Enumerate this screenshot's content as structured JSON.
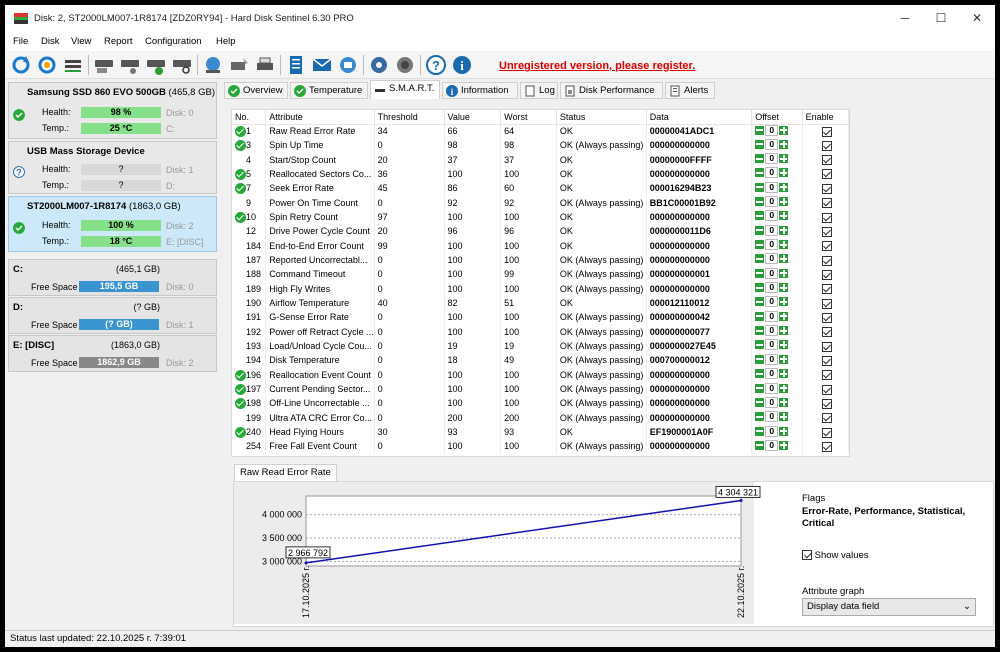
{
  "window": {
    "title": "Disk: 2, ST2000LM007-1R8174 [ZDZ0RY94]  -  Hard Disk Sentinel 6.30 PRO",
    "minimize": "─",
    "maximize": "☐",
    "close": "✕"
  },
  "menu": [
    "File",
    "Disk",
    "View",
    "Report",
    "Configuration",
    "Help"
  ],
  "toolbar": {
    "icons": [
      "refresh-icon",
      "refresh-all-icon",
      "disk-details-icon",
      "disk-test-icon",
      "disk-surface-icon",
      "disk-ok-icon",
      "disk-search-icon",
      "network-icon",
      "tools-icon",
      "printer-icon",
      "report-icon",
      "email-icon",
      "send-icon",
      "settings-icon",
      "sound-icon",
      "help-icon",
      "info-icon"
    ],
    "unregistered": "Unregistered version, please register."
  },
  "disks": [
    {
      "name": "Samsung SSD 860 EVO 500GB",
      "size": "(465,8 GB)",
      "health_label": "Health:",
      "health": "98 %",
      "health_pct": 98,
      "temp_label": "Temp.:",
      "temp": "25 °C",
      "disk_no": "Disk: 0",
      "drive": "C:",
      "status": "ok"
    },
    {
      "name": "USB Mass Storage Device",
      "size": "",
      "health_label": "Health:",
      "health": "?",
      "health_pct": 0,
      "temp_label": "Temp.:",
      "temp": "?",
      "disk_no": "Disk: 1",
      "drive": "D:",
      "status": "unknown"
    },
    {
      "name": "ST2000LM007-1R8174",
      "size": "(1863,0 GB)",
      "health_label": "Health:",
      "health": "100 %",
      "health_pct": 100,
      "temp_label": "Temp.:",
      "temp": "18 °C",
      "disk_no": "Disk: 2",
      "drive": "E: [DISC]",
      "status": "ok"
    }
  ],
  "volumes": [
    {
      "name": "C:",
      "size": "(465,1 GB)",
      "free_label": "Free Space",
      "free": "195,5 GB",
      "disk": "Disk: 0"
    },
    {
      "name": "D:",
      "size": "(? GB)",
      "free_label": "Free Space",
      "free": "(? GB)",
      "disk": "Disk: 1"
    },
    {
      "name": "E: [DISC]",
      "size": "(1863,0 GB)",
      "free_label": "Free Space",
      "free": "1862,9 GB",
      "disk": "Disk: 2"
    }
  ],
  "tabs": [
    "Overview",
    "Temperature",
    "S.M.A.R.T.",
    "Information",
    "Log",
    "Disk Performance",
    "Alerts"
  ],
  "smart": {
    "headers": [
      "No.",
      "Attribute",
      "Threshold",
      "Value",
      "Worst",
      "Status",
      "Data",
      "Offset",
      "Enable"
    ],
    "rows": [
      {
        "ok": true,
        "no": "1",
        "attr": "Raw Read Error Rate",
        "thr": "34",
        "val": "66",
        "worst": "64",
        "status": "OK",
        "data": "00000041ADC1",
        "offset": "0"
      },
      {
        "ok": true,
        "no": "3",
        "attr": "Spin Up Time",
        "thr": "0",
        "val": "98",
        "worst": "98",
        "status": "OK (Always passing)",
        "data": "000000000000",
        "offset": "0"
      },
      {
        "ok": false,
        "no": "4",
        "attr": "Start/Stop Count",
        "thr": "20",
        "val": "37",
        "worst": "37",
        "status": "OK",
        "data": "00000000FFFF",
        "offset": "0"
      },
      {
        "ok": true,
        "no": "5",
        "attr": "Reallocated Sectors Co...",
        "thr": "36",
        "val": "100",
        "worst": "100",
        "status": "OK",
        "data": "000000000000",
        "offset": "0"
      },
      {
        "ok": true,
        "no": "7",
        "attr": "Seek Error Rate",
        "thr": "45",
        "val": "86",
        "worst": "60",
        "status": "OK",
        "data": "000016294B23",
        "offset": "0"
      },
      {
        "ok": false,
        "no": "9",
        "attr": "Power On Time Count",
        "thr": "0",
        "val": "92",
        "worst": "92",
        "status": "OK (Always passing)",
        "data": "BB1C00001B92",
        "offset": "0"
      },
      {
        "ok": true,
        "no": "10",
        "attr": "Spin Retry Count",
        "thr": "97",
        "val": "100",
        "worst": "100",
        "status": "OK",
        "data": "000000000000",
        "offset": "0"
      },
      {
        "ok": false,
        "no": "12",
        "attr": "Drive Power Cycle Count",
        "thr": "20",
        "val": "96",
        "worst": "96",
        "status": "OK",
        "data": "0000000011D6",
        "offset": "0"
      },
      {
        "ok": false,
        "no": "184",
        "attr": "End-to-End Error Count",
        "thr": "99",
        "val": "100",
        "worst": "100",
        "status": "OK",
        "data": "000000000000",
        "offset": "0"
      },
      {
        "ok": false,
        "no": "187",
        "attr": "Reported Uncorrectabl...",
        "thr": "0",
        "val": "100",
        "worst": "100",
        "status": "OK (Always passing)",
        "data": "000000000000",
        "offset": "0"
      },
      {
        "ok": false,
        "no": "188",
        "attr": "Command Timeout",
        "thr": "0",
        "val": "100",
        "worst": "99",
        "status": "OK (Always passing)",
        "data": "000000000001",
        "offset": "0"
      },
      {
        "ok": false,
        "no": "189",
        "attr": "High Fly Writes",
        "thr": "0",
        "val": "100",
        "worst": "100",
        "status": "OK (Always passing)",
        "data": "000000000000",
        "offset": "0"
      },
      {
        "ok": false,
        "no": "190",
        "attr": "Airflow Temperature",
        "thr": "40",
        "val": "82",
        "worst": "51",
        "status": "OK",
        "data": "000012110012",
        "offset": "0"
      },
      {
        "ok": false,
        "no": "191",
        "attr": "G-Sense Error Rate",
        "thr": "0",
        "val": "100",
        "worst": "100",
        "status": "OK (Always passing)",
        "data": "000000000042",
        "offset": "0"
      },
      {
        "ok": false,
        "no": "192",
        "attr": "Power off Retract Cycle ...",
        "thr": "0",
        "val": "100",
        "worst": "100",
        "status": "OK (Always passing)",
        "data": "000000000077",
        "offset": "0"
      },
      {
        "ok": false,
        "no": "193",
        "attr": "Load/Unload Cycle Cou...",
        "thr": "0",
        "val": "19",
        "worst": "19",
        "status": "OK (Always passing)",
        "data": "0000000027E45",
        "offset": "0"
      },
      {
        "ok": false,
        "no": "194",
        "attr": "Disk Temperature",
        "thr": "0",
        "val": "18",
        "worst": "49",
        "status": "OK (Always passing)",
        "data": "000700000012",
        "offset": "0"
      },
      {
        "ok": true,
        "no": "196",
        "attr": "Reallocation Event Count",
        "thr": "0",
        "val": "100",
        "worst": "100",
        "status": "OK (Always passing)",
        "data": "000000000000",
        "offset": "0"
      },
      {
        "ok": true,
        "no": "197",
        "attr": "Current Pending Sector...",
        "thr": "0",
        "val": "100",
        "worst": "100",
        "status": "OK (Always passing)",
        "data": "000000000000",
        "offset": "0"
      },
      {
        "ok": true,
        "no": "198",
        "attr": "Off-Line Uncorrectable ...",
        "thr": "0",
        "val": "100",
        "worst": "100",
        "status": "OK (Always passing)",
        "data": "000000000000",
        "offset": "0"
      },
      {
        "ok": false,
        "no": "199",
        "attr": "Ultra ATA CRC Error Co...",
        "thr": "0",
        "val": "200",
        "worst": "200",
        "status": "OK (Always passing)",
        "data": "000000000000",
        "offset": "0"
      },
      {
        "ok": true,
        "no": "240",
        "attr": "Head Flying Hours",
        "thr": "30",
        "val": "93",
        "worst": "93",
        "status": "OK",
        "data": "EF1900001A0F",
        "offset": "0"
      },
      {
        "ok": false,
        "no": "254",
        "attr": "Free Fall Event Count",
        "thr": "0",
        "val": "100",
        "worst": "100",
        "status": "OK (Always passing)",
        "data": "000000000000",
        "offset": "0"
      }
    ]
  },
  "graph": {
    "tab": "Raw Read Error Rate",
    "flags_label": "Flags",
    "flags": "Error-Rate, Performance, Statistical, Critical",
    "show_values": "Show values",
    "attr_graph_label": "Attribute graph",
    "attr_graph_value": "Display data field"
  },
  "chart_data": {
    "type": "line",
    "x": [
      "17.10.2025 г.",
      "22.10.2025 г."
    ],
    "values": [
      2966792,
      4304321
    ],
    "value_labels": [
      "2 966 792",
      "4 304 321"
    ],
    "yticks": [
      "3 000 000",
      "3 500 000",
      "4 000 000"
    ],
    "ytick_values": [
      3000000,
      3500000,
      4000000
    ],
    "ylim": [
      2900000,
      4400000
    ],
    "grid": true
  },
  "status": "Status last updated: 22.10.2025 г. 7:39:01"
}
